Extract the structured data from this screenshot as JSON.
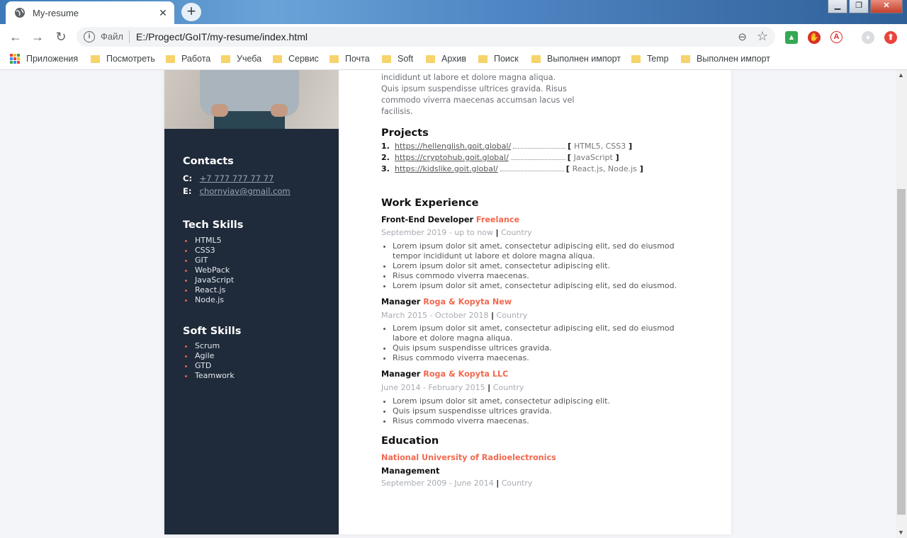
{
  "browser": {
    "tab_title": "My-resume",
    "address_scheme": "Файл",
    "address_url": "E:/Progect/GoIT/my-resume/index.html"
  },
  "bookmarks": [
    "Приложения",
    "Посмотреть",
    "Работа",
    "Учеба",
    "Сервис",
    "Почта",
    "Soft",
    "Архив",
    "Поиск",
    "Выполнен импорт",
    "Temp",
    "Выполнен импорт"
  ],
  "sidebar": {
    "contacts_title": "Contacts",
    "phone_label": "C:",
    "phone": "+7 777 777 77 77",
    "email_label": "E:",
    "email": "chornyiav@gmail.com",
    "tech_title": "Tech Skills",
    "tech_skills": [
      "HTML5",
      "CSS3",
      "GIT",
      "WebPack",
      "JavaScript",
      "React.js",
      "Node.js"
    ],
    "soft_title": "Soft Skills",
    "soft_skills": [
      "Scrum",
      "Agile",
      "GTD",
      "Teamwork"
    ]
  },
  "about": {
    "lines": [
      "incididunt ut labore et dolore magna aliqua.",
      "Quis ipsum suspendisse ultrices gravida. Risus",
      "commodo viverra maecenas accumsan lacus vel",
      "facilisis."
    ]
  },
  "projects": {
    "title": "Projects",
    "items": [
      {
        "num": "1.",
        "url": "https://hellenglish.goit.global/",
        "tech": "HTML5, CSS3"
      },
      {
        "num": "2.",
        "url": "https://cryptohub.goit.global/",
        "tech": "JavaScript"
      },
      {
        "num": "3.",
        "url": "https://kidslike.goit.global/",
        "tech": "React.js, Node.js"
      }
    ]
  },
  "work": {
    "title": "Work Experience",
    "jobs": [
      {
        "role": "Front-End Developer",
        "company": "Freelance",
        "dates": "September 2019 - up to now",
        "location": "Country",
        "bullets": [
          "Lorem ipsum dolor sit amet, consectetur adipiscing elit, sed do eiusmod tempor incididunt ut labore et dolore magna aliqua.",
          "Lorem ipsum dolor sit amet, consectetur adipiscing elit.",
          "Risus commodo viverra maecenas.",
          "Lorem ipsum dolor sit amet, consectetur adipiscing elit, sed do eiusmod."
        ]
      },
      {
        "role": "Manager",
        "company": "Roga & Kopyta New",
        "dates": "March 2015 - October 2018",
        "location": "Country",
        "bullets": [
          "Lorem ipsum dolor sit amet, consectetur adipiscing elit, sed do eiusmod labore et dolore magna aliqua.",
          "Quis ipsum suspendisse ultrices gravida.",
          "Risus commodo viverra maecenas."
        ]
      },
      {
        "role": "Manager",
        "company": "Roga & Kopyta LLC",
        "dates": "June 2014 - February 2015",
        "location": "Country",
        "bullets": [
          "Lorem ipsum dolor sit amet, consectetur adipiscing elit.",
          "Quis ipsum suspendisse ultrices gravida.",
          "Risus commodo viverra maecenas."
        ]
      }
    ]
  },
  "education": {
    "title": "Education",
    "university": "National University of Radioelectronics",
    "degree": "Management",
    "dates": "September 2009 - June 2014",
    "location": "Country"
  },
  "colors": {
    "accent": "#f0694f",
    "sidebar_bg": "#1f2a3a"
  }
}
